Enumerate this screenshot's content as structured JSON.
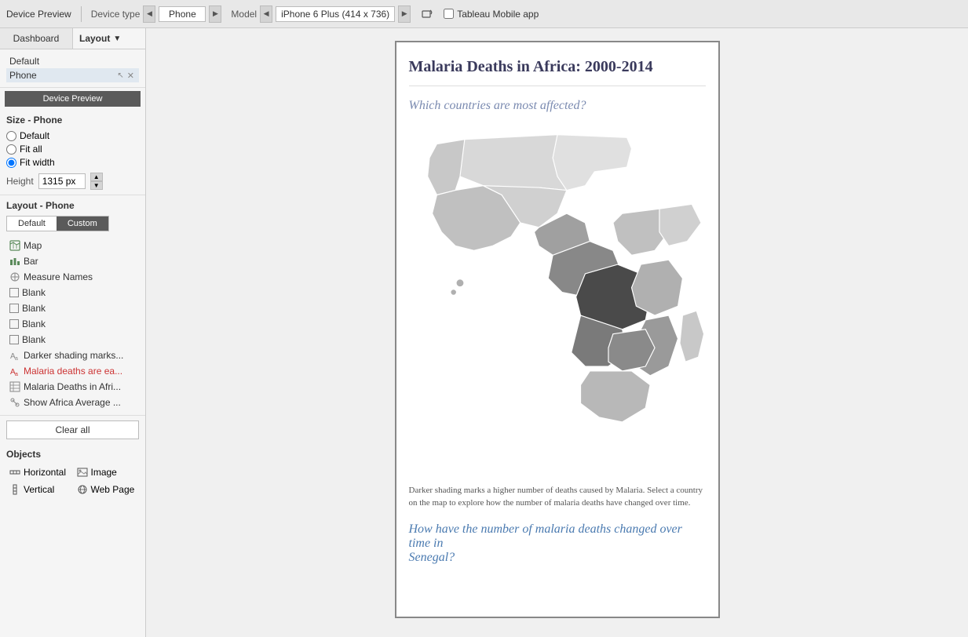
{
  "topbar": {
    "device_preview_label": "Device Preview",
    "device_type_label": "Device type",
    "device_value": "Phone",
    "model_label": "Model",
    "model_value": "iPhone 6 Plus (414 x 736)",
    "tablet_app_label": "Tableau Mobile app"
  },
  "tabs": {
    "dashboard_label": "Dashboard",
    "layout_label": "Layout"
  },
  "left": {
    "default_label": "Default",
    "phone_label": "Phone",
    "device_preview_btn": "Device Preview",
    "size_title": "Size - Phone",
    "radio_default": "Default",
    "radio_fit_all": "Fit all",
    "radio_fit_width": "Fit width",
    "height_label": "Height",
    "height_value": "1315 px",
    "layout_title": "Layout - Phone",
    "toggle_default": "Default",
    "toggle_custom": "Custom",
    "sheets": [
      {
        "name": "Map",
        "icon": "map"
      },
      {
        "name": "Bar",
        "icon": "bar"
      },
      {
        "name": "Measure Names",
        "icon": "measure"
      },
      {
        "name": "Blank",
        "icon": "blank"
      },
      {
        "name": "Blank",
        "icon": "blank"
      },
      {
        "name": "Blank",
        "icon": "blank"
      },
      {
        "name": "Blank",
        "icon": "blank"
      },
      {
        "name": "Darker shading marks...",
        "icon": "text"
      },
      {
        "name": "Malaria deaths are ea...",
        "icon": "text",
        "red": true
      },
      {
        "name": "Malaria Deaths in Afri...",
        "icon": "table"
      },
      {
        "name": "Show Africa Average ...",
        "icon": "filter"
      }
    ],
    "clear_all": "Clear all",
    "objects_title": "Objects",
    "objects": [
      {
        "name": "Horizontal",
        "icon": "horizontal"
      },
      {
        "name": "Image",
        "icon": "image"
      },
      {
        "name": "Vertical",
        "icon": "vertical"
      },
      {
        "name": "Web Page",
        "icon": "web"
      }
    ]
  },
  "dashboard": {
    "title": "Malaria Deaths in Africa: 2000-2014",
    "question1": "Which countries are most affected?",
    "caption": "Darker shading marks a higher number of deaths caused by Malaria. Select a country on the map to explore how the number of malaria deaths have changed over time.",
    "question2_prefix": "How have the number of malaria deaths changed over time in",
    "question2_country": "Senegal?"
  }
}
